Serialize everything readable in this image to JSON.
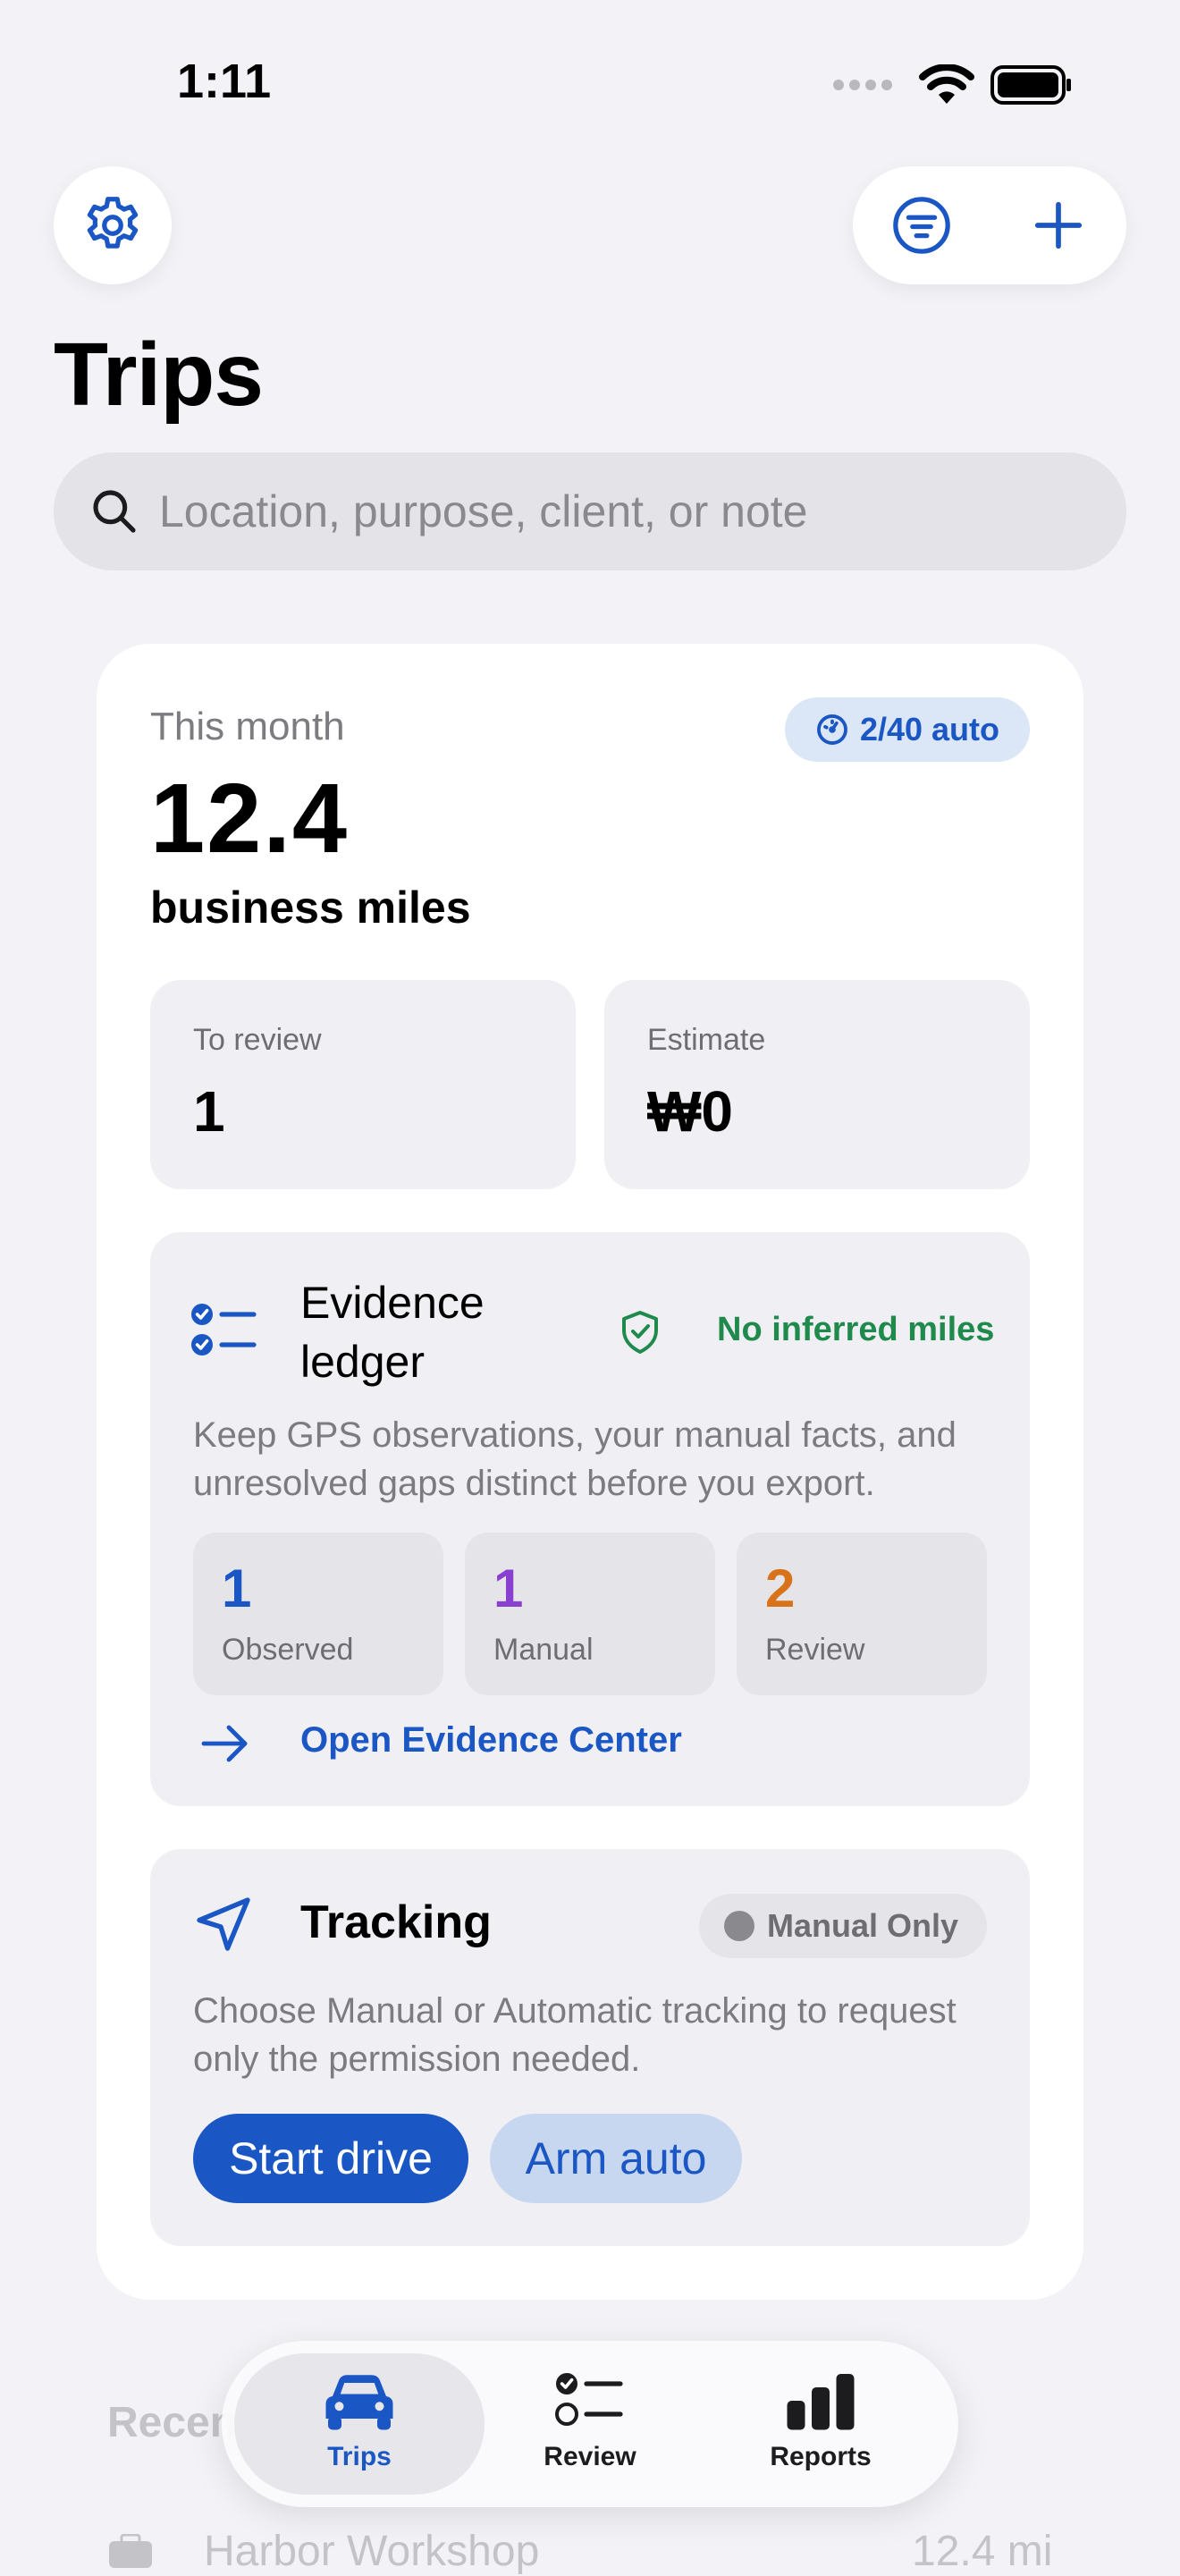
{
  "status_bar": {
    "time": "1:11"
  },
  "header": {
    "title": "Trips"
  },
  "search": {
    "placeholder": "Location, purpose, client, or note"
  },
  "summary": {
    "period_label": "This month",
    "auto_badge": "2/40 auto",
    "miles_value": "12.4",
    "miles_unit": "business miles",
    "to_review_label": "To review",
    "to_review_value": "1",
    "estimate_label": "Estimate",
    "estimate_value": "₩0"
  },
  "evidence": {
    "title": "Evidence ledger",
    "status": "No inferred miles",
    "description": "Keep GPS observations, your manual facts, and unresolved gaps distinct before you export.",
    "counts": [
      {
        "value": "1",
        "label": "Observed",
        "color": "#1a56c4"
      },
      {
        "value": "1",
        "label": "Manual",
        "color": "#8a3fd1"
      },
      {
        "value": "2",
        "label": "Review",
        "color": "#d9731a"
      }
    ],
    "link": "Open Evidence Center"
  },
  "tracking": {
    "title": "Tracking",
    "mode_badge": "Manual Only",
    "description": "Choose Manual or Automatic tracking to request only the permission needed.",
    "start_button": "Start drive",
    "arm_button": "Arm auto"
  },
  "recent": {
    "heading": "Recen",
    "first_trip_title": "Harbor Workshop",
    "first_trip_value": "12.4 mi"
  },
  "tabs": [
    {
      "label": "Trips",
      "icon": "car-icon",
      "active": true
    },
    {
      "label": "Review",
      "icon": "checklist-icon",
      "active": false
    },
    {
      "label": "Reports",
      "icon": "bar-chart-icon",
      "active": false
    }
  ],
  "colors": {
    "accent": "#1a56c4",
    "success": "#1f8a4c",
    "background": "#f2f2f7"
  }
}
